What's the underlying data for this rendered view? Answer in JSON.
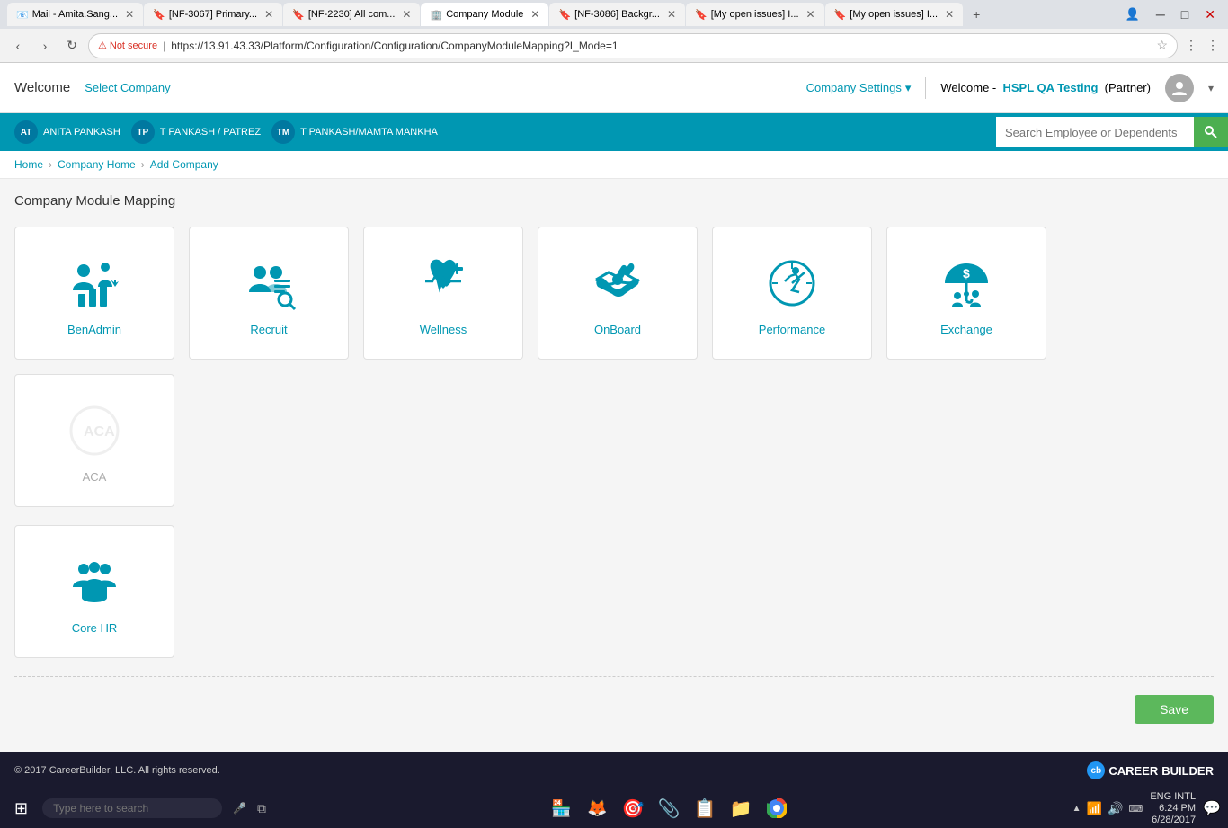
{
  "browser": {
    "tabs": [
      {
        "label": "Mail - Amita.Sang...",
        "icon": "📧",
        "active": false
      },
      {
        "label": "[NF-3067] Primary...",
        "icon": "🔖",
        "active": false
      },
      {
        "label": "[NF-2230] All com...",
        "icon": "🔖",
        "active": false
      },
      {
        "label": "Company Module",
        "icon": "🏢",
        "active": true
      },
      {
        "label": "[NF-3086] Backgr...",
        "icon": "🔖",
        "active": false
      },
      {
        "label": "[My open issues] I...",
        "icon": "🔖",
        "active": false
      },
      {
        "label": "[My open issues] I...",
        "icon": "🔖",
        "active": false
      }
    ],
    "address": "https://13.91.43.33/Platform/Configuration/Configuration/CompanyModuleMapping?I_Mode=1",
    "security_label": "Not secure"
  },
  "header": {
    "welcome_label": "Welcome",
    "select_company_label": "Select Company",
    "company_settings_label": "Company Settings",
    "welcome_user_prefix": "Welcome -",
    "user_name": "HSPL QA Testing",
    "user_role": "(Partner)"
  },
  "teal_strip": {
    "users": [
      {
        "initials": "AT",
        "name": "ANITA PANKASH"
      },
      {
        "initials": "TP",
        "name": "T PANKASH / PATREZ"
      },
      {
        "initials": "TM",
        "name": "T PANKASH/MAMTA MANKHA"
      }
    ]
  },
  "search": {
    "placeholder": "Search Employee or Dependents"
  },
  "breadcrumb": {
    "items": [
      "Home",
      "Company Home",
      "Add Company"
    ]
  },
  "page": {
    "title": "Company Module Mapping",
    "save_label": "Save"
  },
  "modules": [
    {
      "id": "benadmin",
      "label": "BenAdmin",
      "enabled": true
    },
    {
      "id": "recruit",
      "label": "Recruit",
      "enabled": true
    },
    {
      "id": "wellness",
      "label": "Wellness",
      "enabled": true
    },
    {
      "id": "onboard",
      "label": "OnBoard",
      "enabled": true
    },
    {
      "id": "performance",
      "label": "Performance",
      "enabled": true
    },
    {
      "id": "exchange",
      "label": "Exchange",
      "enabled": true
    },
    {
      "id": "aca",
      "label": "ACA",
      "enabled": false
    },
    {
      "id": "corehr",
      "label": "Core HR",
      "enabled": true
    }
  ],
  "footer": {
    "copyright": "© 2017 CareerBuilder, LLC. All rights reserved.",
    "logo_label": "CAREER",
    "logo_bold": "BUILDER"
  },
  "taskbar": {
    "search_placeholder": "Type here to search",
    "language": "ENG",
    "locale": "INTL",
    "time": "6:24 PM",
    "date": "6/28/2017"
  }
}
